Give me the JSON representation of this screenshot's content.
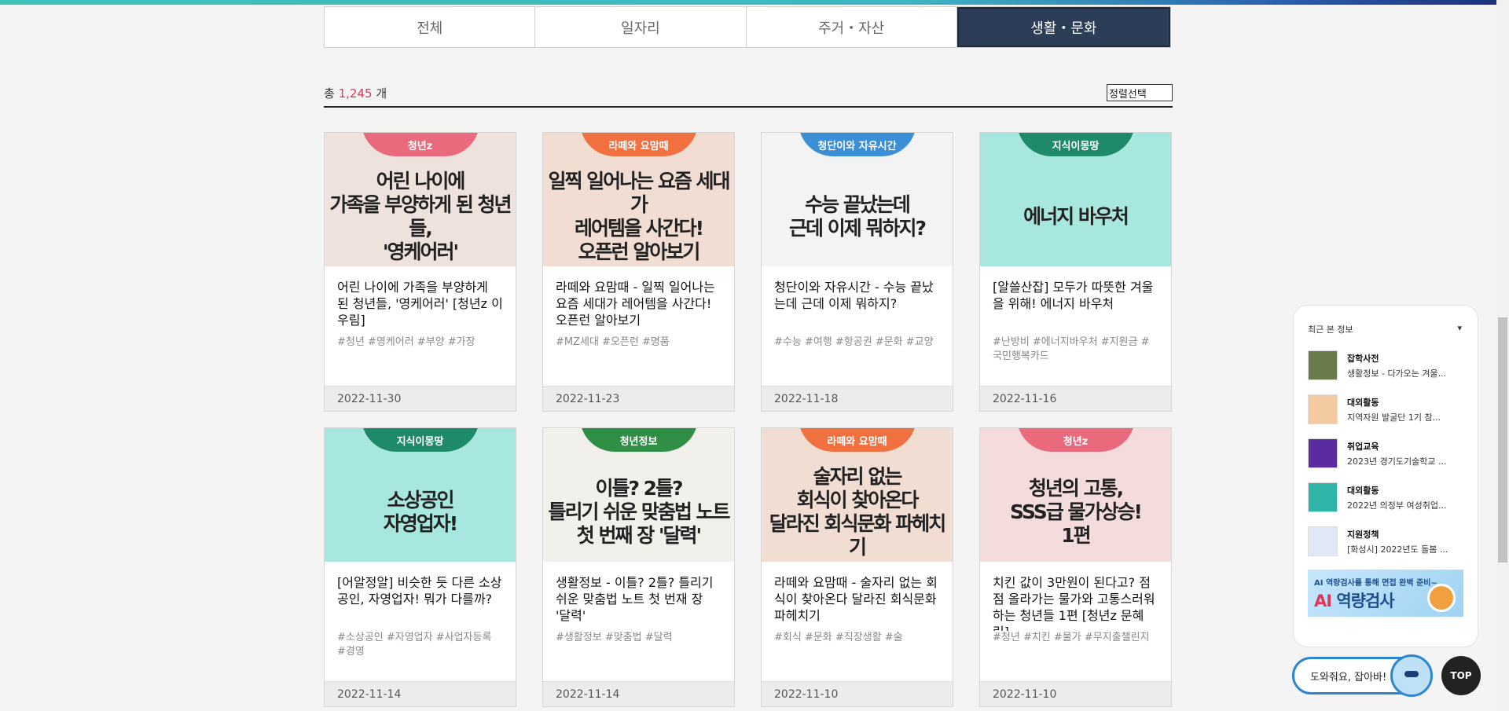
{
  "tabs": [
    "전체",
    "일자리",
    "주거・자산",
    "생활・문화"
  ],
  "count": {
    "prefix": "총",
    "value": "1,245",
    "suffix": "개"
  },
  "sort_label": "정렬선택",
  "cards": [
    {
      "badge": "청년z",
      "badge_color": "#e86a7c",
      "headline": "어린 나이에\n가족을 부양하게 된 청년들,\n'영케어러'",
      "thumb_bg": "#efe1dc",
      "title": "어린 나이에 가족을 부양하게 된 청년들, '영케어러' [청년z 이우림]",
      "tags": "#청년 #영케어러 #부양 #가장",
      "date": "2022-11-30"
    },
    {
      "badge": "라떼와 요맘때",
      "badge_color": "#f07040",
      "headline": "일찍 일어나는 요즘 세대가\n레어템을 사간다!\n오픈런 알아보기",
      "thumb_bg": "#f1ddd2",
      "title": "라떼와 요맘때 - 일찍 일어나는 요즘 세대가 레어템을 사간다! 오픈런 알아보기",
      "tags": "#MZ세대 #오픈런 #명품",
      "date": "2022-11-23"
    },
    {
      "badge": "청단이와 자유시간",
      "badge_color": "#3a8fd6",
      "headline": "수능 끝났는데\n근데 이제 뭐하지?",
      "thumb_bg": "#f3f3f3",
      "title": "청단이와 자유시간 - 수능 끝났는데 근데 이제 뭐하지?",
      "tags": "#수능 #여행 #항공권 #문화 #교양",
      "date": "2022-11-18"
    },
    {
      "badge": "지식이몽땅",
      "badge_color": "#1f8a6a",
      "headline": "에너지 바우처",
      "thumb_bg": "#a8e6e0",
      "title": "[알쓸산잡] 모두가 따뜻한 겨울을 위해! 에너지 바우처",
      "tags": "#난방비 #에너지바우처 #지원금 #국민행복카드",
      "date": "2022-11-16"
    },
    {
      "badge": "지식이몽땅",
      "badge_color": "#1f8a6a",
      "headline": "소상공인\n자영업자!",
      "thumb_bg": "#a8e6e0",
      "title": "[어알정알] 비슷한 듯 다른 소상공인, 자영업자! 뭐가 다를까?",
      "tags": "#소상공인 #자영업자 #사업자등록 #경영",
      "date": "2022-11-14"
    },
    {
      "badge": "청년정보",
      "badge_color": "#2f8f45",
      "headline": "이틀? 2틀?\n틀리기 쉬운 맞춤법 노트\n첫 번째 장 '달력'",
      "thumb_bg": "#f2f0ea",
      "title": "생활정보 - 이틀? 2틀? 틀리기 쉬운 맞춤법 노트 첫 번재 장 '달력'",
      "tags": "#생활정보 #맞춤법 #달력",
      "date": "2022-11-14"
    },
    {
      "badge": "라떼와 요맘때",
      "badge_color": "#f07040",
      "headline": "술자리 없는\n회식이 찾아온다\n달라진 회식문화 파헤치기",
      "thumb_bg": "#f1ddd2",
      "title": "라떼와 요맘때 - 술자리 없는 회식이 찾아온다 달라진 회식문화 파헤치기",
      "tags": "#회식 #문화 #직장생활 #술",
      "date": "2022-11-10"
    },
    {
      "badge": "청년z",
      "badge_color": "#e86a7c",
      "headline": "청년의 고통,\nSSS급 물가상승!\n1편",
      "thumb_bg": "#f5dcdc",
      "title": "치킨 값이 3만원이 된다고? 점점 올라가는 물가와 고통스러워하는 청년들 1편 [청년z 문혜린]",
      "tags": "#청년 #치킨 #물가 #무지출챌린지",
      "date": "2022-11-10"
    }
  ],
  "sidebar": {
    "title": "최근 본 정보",
    "items": [
      {
        "category": "잡학사전",
        "desc": "생활정보 - 다가오는 겨울...",
        "icon_color": "#6b7a4a"
      },
      {
        "category": "대외활동",
        "desc": "지역자원 발굴단 1기 참...",
        "icon_color": "#f3c9a0"
      },
      {
        "category": "취업교육",
        "desc": "2023년 경기도기술학교 ...",
        "icon_color": "#5a2ca0"
      },
      {
        "category": "대외활동",
        "desc": "2022년 의정부 여성취업...",
        "icon_color": "#2fb5a8"
      },
      {
        "category": "지원정책",
        "desc": "[화성시] 2022년도 돌봄 ...",
        "icon_color": "#dfe8f4"
      }
    ],
    "ad": {
      "sub": "AI 역량검사를 통해 면접 완벽 준비~",
      "big_prefix": "AI",
      "big_rest": "역량검사"
    }
  },
  "helper_label": "도와줘요, 잡아바!",
  "top_label": "TOP"
}
